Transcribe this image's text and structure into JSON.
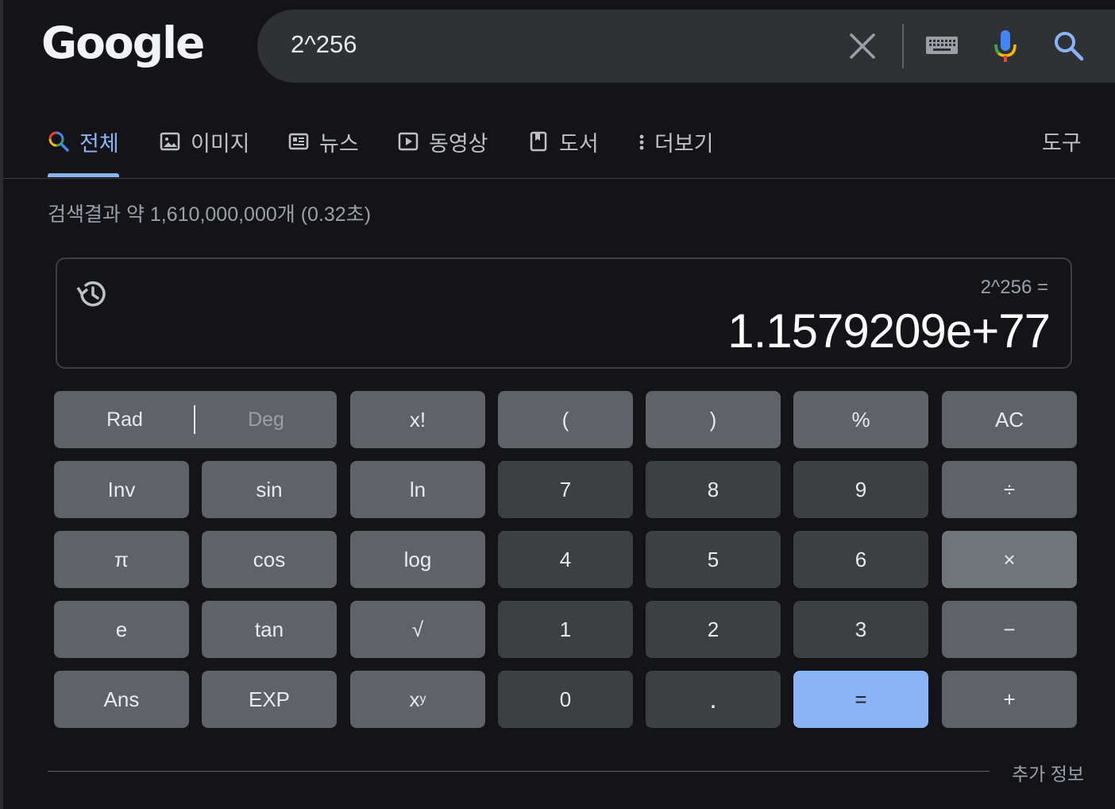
{
  "logo": {
    "text": "Google"
  },
  "search": {
    "query": "2^256"
  },
  "tabs": [
    {
      "label": "전체",
      "icon": "search-icon"
    },
    {
      "label": "이미지",
      "icon": "image-icon"
    },
    {
      "label": "뉴스",
      "icon": "news-icon"
    },
    {
      "label": "동영상",
      "icon": "video-icon"
    },
    {
      "label": "도서",
      "icon": "book-icon"
    },
    {
      "label": "더보기",
      "icon": "more-vert-icon"
    }
  ],
  "tools": {
    "label": "도구"
  },
  "stats": {
    "text": "검색결과 약 1,610,000,000개 (0.32초)"
  },
  "calculator": {
    "expression": "2^256 =",
    "result": "1.1579209e+77",
    "angle_mode": {
      "rad": "Rad",
      "deg": "Deg",
      "selected": "Rad"
    },
    "keys": {
      "fact": "x!",
      "lparen": "(",
      "rparen": ")",
      "percent": "%",
      "ac": "AC",
      "inv": "Inv",
      "sin": "sin",
      "ln": "ln",
      "n7": "7",
      "n8": "8",
      "n9": "9",
      "div": "÷",
      "pi": "π",
      "cos": "cos",
      "log": "log",
      "n4": "4",
      "n5": "5",
      "n6": "6",
      "mul": "×",
      "e": "e",
      "tan": "tan",
      "sqrt": "√",
      "n1": "1",
      "n2": "2",
      "n3": "3",
      "sub": "−",
      "ans": "Ans",
      "exp": "EXP",
      "pow_base": "x",
      "pow_exp": "y",
      "n0": "0",
      "dot": ".",
      "eq": "=",
      "add": "+"
    }
  },
  "footer": {
    "more_info": "추가 정보"
  },
  "colors": {
    "background": "#141418",
    "accent": "#8ab4f8",
    "search_box": "#303134"
  }
}
